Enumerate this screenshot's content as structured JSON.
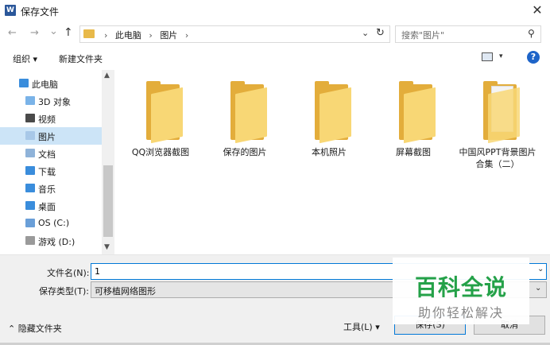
{
  "window": {
    "title": "保存文件",
    "app_icon": "W",
    "close_glyph": "✕"
  },
  "nav": {
    "back_glyph": "←",
    "forward_glyph": "→",
    "history_glyph": "⌄",
    "up_glyph": "↑",
    "breadcrumbs": [
      "此电脑",
      "图片"
    ],
    "sep_glyph": "›",
    "dropdown_glyph": "⌄",
    "refresh_glyph": "↻"
  },
  "search": {
    "placeholder": "搜索\"图片\"",
    "icon_glyph": "⚲"
  },
  "toolbar": {
    "organize_label": "组织 ▾",
    "new_folder_label": "新建文件夹",
    "view_caret": "▾",
    "help_glyph": "?"
  },
  "sidebar": {
    "items": [
      {
        "label": "此电脑",
        "icon": "pc-icon",
        "color": "#3a8ddc"
      },
      {
        "label": "3D 对象",
        "icon": "cube-icon",
        "color": "#7ab3e8"
      },
      {
        "label": "视频",
        "icon": "video-icon",
        "color": "#4a4a4a"
      },
      {
        "label": "图片",
        "icon": "picture-icon",
        "color": "#a8c8e8"
      },
      {
        "label": "文档",
        "icon": "document-icon",
        "color": "#8fb3d9"
      },
      {
        "label": "下载",
        "icon": "download-icon",
        "color": "#3a8ddc"
      },
      {
        "label": "音乐",
        "icon": "music-icon",
        "color": "#3a8ddc"
      },
      {
        "label": "桌面",
        "icon": "desktop-icon",
        "color": "#3a8ddc"
      },
      {
        "label": "OS (C:)",
        "icon": "drive-c-icon",
        "color": "#6a9fd8"
      },
      {
        "label": "游戏 (D:)",
        "icon": "drive-d-icon",
        "color": "#9a9a9a"
      }
    ],
    "selected_index": 3,
    "scroll_up_glyph": "▲",
    "scroll_down_glyph": "▼"
  },
  "folders": [
    {
      "label": "QQ浏览器截图"
    },
    {
      "label": "保存的图片"
    },
    {
      "label": "本机照片"
    },
    {
      "label": "屏幕截图"
    },
    {
      "label": "中国风PPT背景图片合集（二）"
    }
  ],
  "form": {
    "filename_label": "文件名(N):",
    "filename_value": "1",
    "filetype_label": "保存类型(T):",
    "filetype_value": "可移植网络图形",
    "select_caret": "⌄"
  },
  "footer": {
    "hide_folders_label": "⌃  隐藏文件夹",
    "tools_label": "工具(L)  ▾",
    "save_label": "保存(S)",
    "cancel_label": "取消"
  },
  "watermark": {
    "title": "百科全说",
    "subtitle": "助你轻松解决"
  }
}
